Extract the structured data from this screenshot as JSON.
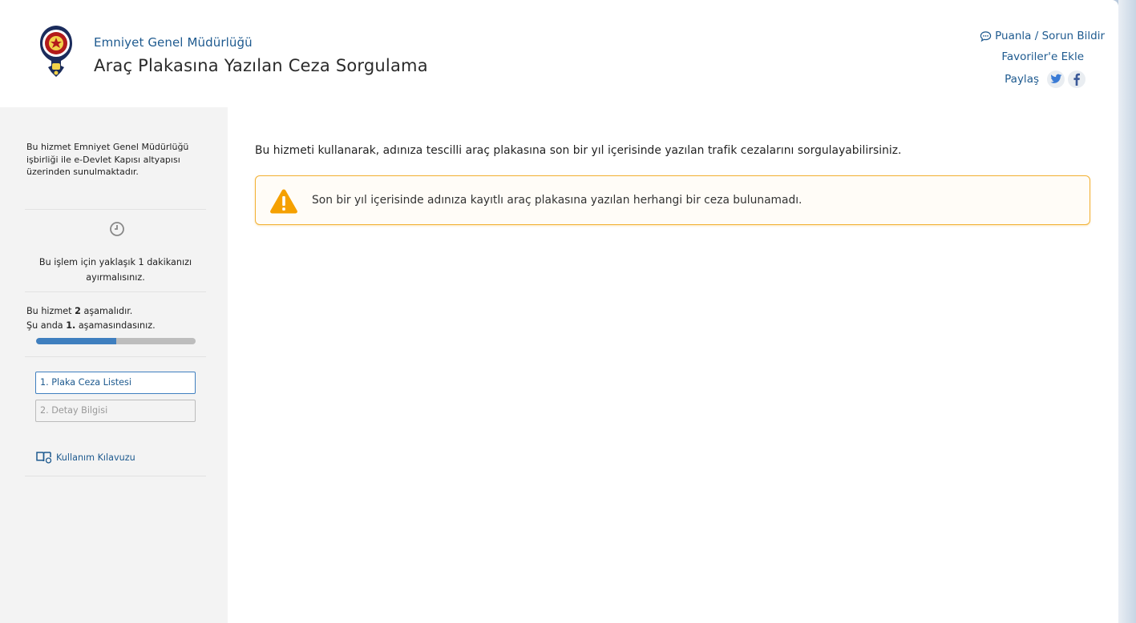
{
  "header": {
    "org_name": "Emniyet Genel Müdürlüğü",
    "title": "Araç Plakasına Yazılan Ceza Sorgulama",
    "rate_link": "Puanla / Sorun Bildir",
    "favorites_link": "Favoriler'e Ekle",
    "share_label": "Paylaş",
    "logo_icon": "police-badge-logo",
    "social_icons": [
      "twitter-icon",
      "facebook-icon"
    ]
  },
  "sidebar": {
    "intro": "Bu hizmet Emniyet Genel Müdürlüğü işbirliği ile e-Devlet Kapısı altyapısı üzerinden sunulmaktadır.",
    "time_text": "Bu işlem için yaklaşık 1 dakikanızı ayırmalısınız.",
    "steps_line1_pre": "Bu hizmet ",
    "steps_total": "2",
    "steps_line1_post": " aşamalıdır.",
    "steps_line2_pre": "Şu anda ",
    "steps_current": "1.",
    "steps_line2_post": " aşamasındasınız.",
    "progress_fraction": 0.5,
    "step_buttons": [
      "1. Plaka Ceza Listesi",
      "2. Detay Bilgisi"
    ],
    "guide_link": "Kullanım Kılavuzu"
  },
  "main": {
    "intro": "Bu hizmeti kullanarak, adınıza tescilli araç plakasına son bir yıl içerisinde yazılan trafik cezalarını sorgulayabilirsiniz.",
    "alert": "Son bir yıl içerisinde adınıza kayıtlı araç plakasına yazılan herhangi bir ceza bulunamadı."
  },
  "colors": {
    "link_blue": "#1e5a8f",
    "progress_blue": "#3f7fbf",
    "alert_border": "#f2b134",
    "warning_orange": "#f5a000"
  }
}
